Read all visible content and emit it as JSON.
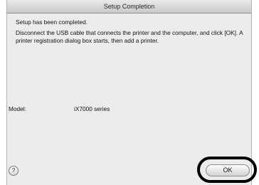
{
  "window": {
    "title": "Setup Completion"
  },
  "message": {
    "line1": "Setup has been completed.",
    "line2": "Disconnect the USB cable that connects the printer and the computer, and click [OK]. A printer registration dialog box starts, then add a printer."
  },
  "model": {
    "label": "Model:",
    "value": "iX7000 series"
  },
  "buttons": {
    "help_label": "?",
    "ok_label": "OK"
  }
}
